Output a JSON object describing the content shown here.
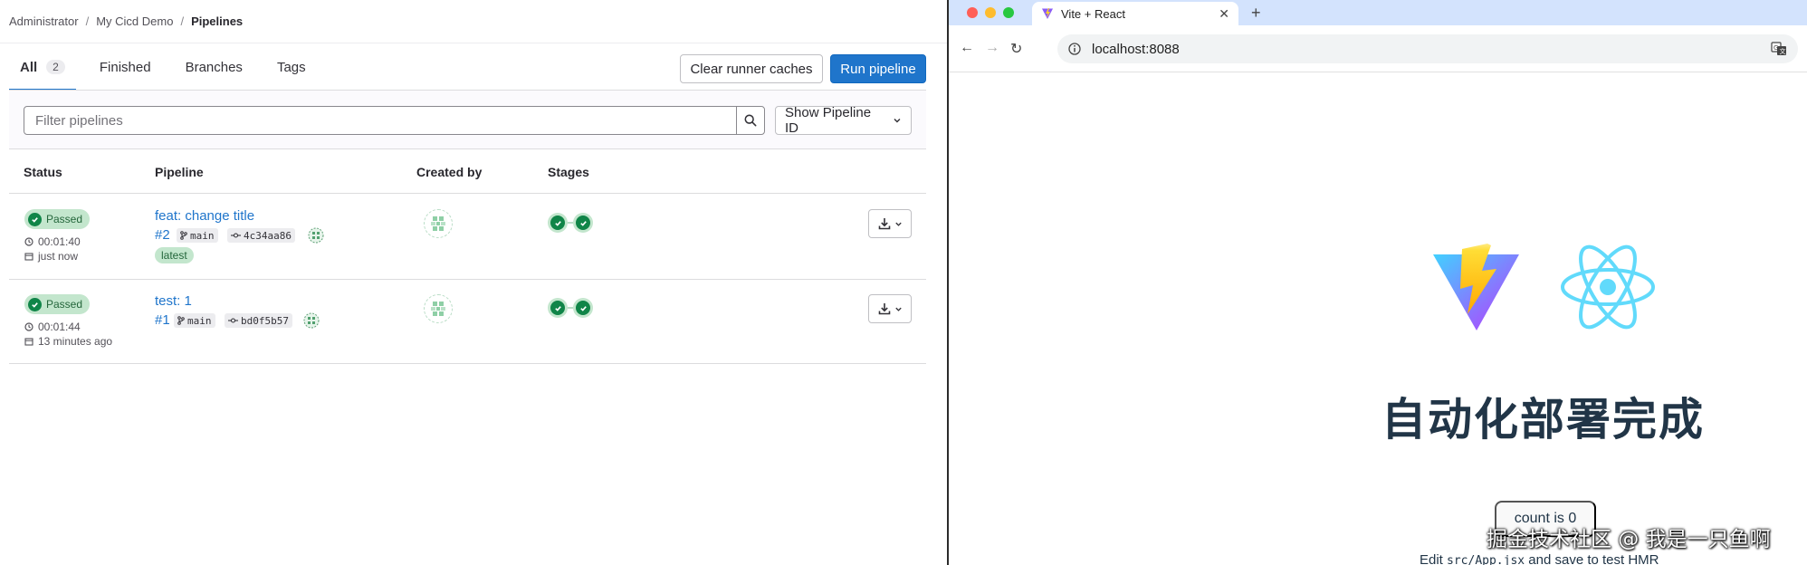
{
  "breadcrumb": {
    "items": [
      "Administrator",
      "My Cicd Demo",
      "Pipelines"
    ]
  },
  "tabs": [
    {
      "label": "All",
      "count": "2"
    },
    {
      "label": "Finished"
    },
    {
      "label": "Branches"
    },
    {
      "label": "Tags"
    }
  ],
  "actions": {
    "clear_caches": "Clear runner caches",
    "run_pipeline": "Run pipeline"
  },
  "filter": {
    "placeholder": "Filter pipelines",
    "show_id": "Show Pipeline ID"
  },
  "table": {
    "headers": [
      "Status",
      "Pipeline",
      "Created by",
      "Stages"
    ]
  },
  "pipelines": [
    {
      "status": "Passed",
      "duration": "00:01:40",
      "finished": "just now",
      "title": "feat: change title",
      "id": "#2",
      "branch": "main",
      "commit": "4c34aa86",
      "tag": "latest"
    },
    {
      "status": "Passed",
      "duration": "00:01:44",
      "finished": "13 minutes ago",
      "title": "test: 1",
      "id": "#1",
      "branch": "main",
      "commit": "bd0f5b57"
    }
  ],
  "browser": {
    "tab_title": "Vite + React",
    "url": "localhost:8088",
    "page": {
      "heading": "自动化部署完成",
      "count_label": "count is 0",
      "edit_prefix": "Edit ",
      "edit_code": "src/App.jsx",
      "edit_suffix": " and save to test HMR"
    }
  },
  "watermark": "掘金技术社区 @ 我是一只鱼啊",
  "colors": {
    "primary": "#1f75cb",
    "success": "#108548",
    "success_bg": "#c3e6cd",
    "heading": "#213547"
  }
}
